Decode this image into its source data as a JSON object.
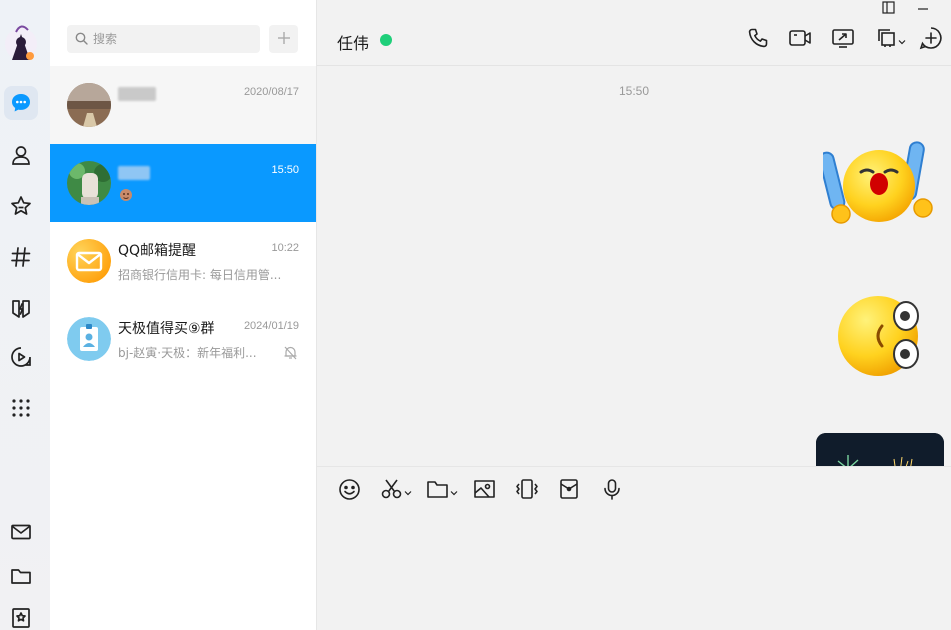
{
  "nav": {
    "items": [
      "message-icon",
      "contacts-icon",
      "favorites-icon",
      "channels-icon",
      "games-icon",
      "video-icon",
      "more-apps-icon"
    ],
    "bottom": [
      "mail-icon",
      "folder-icon",
      "bookmark-icon"
    ]
  },
  "search": {
    "placeholder": "搜索"
  },
  "conversations": [
    {
      "name": "",
      "time": "2020/08/17",
      "preview": ""
    },
    {
      "name": "",
      "time": "15:50",
      "preview": ""
    },
    {
      "name": "QQ邮箱提醒",
      "time": "10:22",
      "preview": "招商银行信用卡: 每日信用管..."
    },
    {
      "name": "天极值得买⑨群",
      "time": "2024/01/19",
      "preview": "bj-赵寅·天极：新年福利..."
    }
  ],
  "chat": {
    "title": "任伟",
    "message_time": "15:50"
  },
  "colors": {
    "accent": "#0a99ff",
    "online": "#1fcf7a"
  }
}
